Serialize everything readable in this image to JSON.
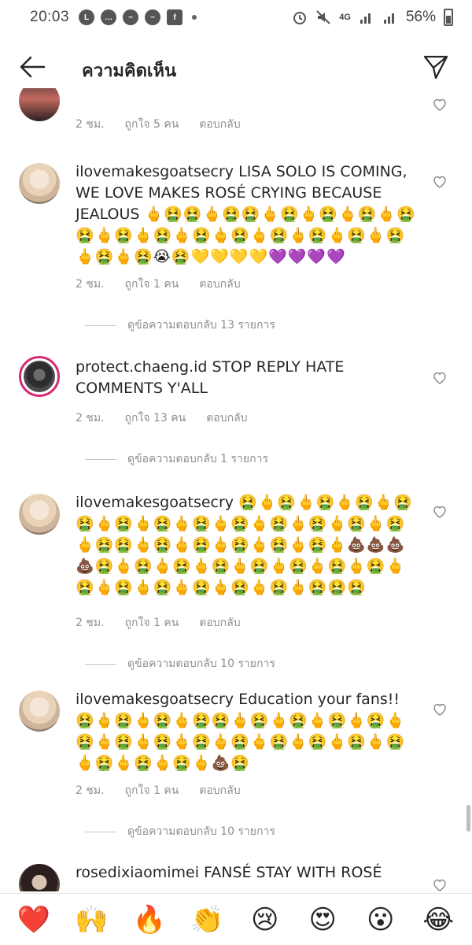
{
  "status_bar": {
    "time": "20:03",
    "network": "4G",
    "battery": "56%",
    "app_icons": [
      "line-icon",
      "chat-icon",
      "messenger-icon",
      "messenger-icon",
      "facebook-icon"
    ]
  },
  "header": {
    "title": "ความคิดเห็น"
  },
  "comments": [
    {
      "username": "",
      "text": "",
      "emojis": "",
      "time": "2 ชม.",
      "likes": "ถูกใจ 5 คน",
      "reply": "ตอบกลับ",
      "view_replies": ""
    },
    {
      "username": "ilovemakesgoatsecry",
      "text": " LISA SOLO IS COMING, WE LOVE MAKES ROSÉ CRYING BECAUSE JEALOUS ",
      "emojis": "🖕🤮🤮🖕🤮🤮🖕🤮🖕🤮🖕🤮🖕🤮🤮🖕🤮🖕🤮🖕🤮🖕🤮🖕🤮🖕🤮🖕🤮🖕🤮🖕🤮🖕🤮😭🤮💛💛💛💛💜💜💜💜",
      "time": "2 ชม.",
      "likes": "ถูกใจ 1 คน",
      "reply": "ตอบกลับ",
      "view_replies": "ดูข้อความตอบกลับ 13 รายการ"
    },
    {
      "username": "protect.chaeng.id",
      "text": " STOP REPLY HATE COMMENTS Y'ALL",
      "emojis": "",
      "time": "2 ชม.",
      "likes": "ถูกใจ 13 คน",
      "reply": "ตอบกลับ",
      "view_replies": "ดูข้อความตอบกลับ 1 รายการ"
    },
    {
      "username": "ilovemakesgoatsecry",
      "text": " ",
      "emojis": "🤮🖕🤮🖕🤮🖕🤮🖕🤮🤮🖕🤮🖕🤮🖕🤮🖕🤮🖕🤮🖕🤮🖕🤮🖕🤮🖕🤮🤮🖕🤮🖕🤮🖕🤮🖕🤮🖕🤮🖕💩💩💩💩🤮🖕🤮🖕🤮🖕🤮🖕🤮🖕🤮🖕🤮🖕🤮🖕🤮🖕🤮🖕🤮🖕🤮🖕🤮🖕🤮🖕🤮🤮🤮",
      "time": "2 ชม.",
      "likes": "ถูกใจ 1 คน",
      "reply": "ตอบกลับ",
      "view_replies": "ดูข้อความตอบกลับ 10 รายการ"
    },
    {
      "username": "ilovemakesgoatsecry",
      "text": " Education your fans!! ",
      "emojis": "🤮🖕🤮🖕🤮🖕🤮🤮🖕🤮🖕🤮🖕🤮🖕🤮🖕🤮🖕🤮🖕🤮🖕🤮🖕🤮🖕🤮🖕🤮🖕🤮🖕🤮🖕🤮🖕🤮🖕🤮🖕💩🤮",
      "time": "2 ชม.",
      "likes": "ถูกใจ 1 คน",
      "reply": "ตอบกลับ",
      "view_replies": "ดูข้อความตอบกลับ 10 รายการ"
    },
    {
      "username": "rosedixiaomimei",
      "text": " FANSÉ STAY WITH ROSÉ",
      "emojis": "",
      "time": "",
      "likes": "",
      "reply": "",
      "view_replies": ""
    }
  ],
  "reactions": [
    "❤️",
    "🙌",
    "🔥",
    "👏",
    "😢",
    "😍",
    "😮",
    "😂"
  ],
  "colors": {
    "text": "#262626",
    "secondary": "#8e8e8e",
    "story_ring": "#d62976",
    "reaction_heart": "#ed4956"
  }
}
